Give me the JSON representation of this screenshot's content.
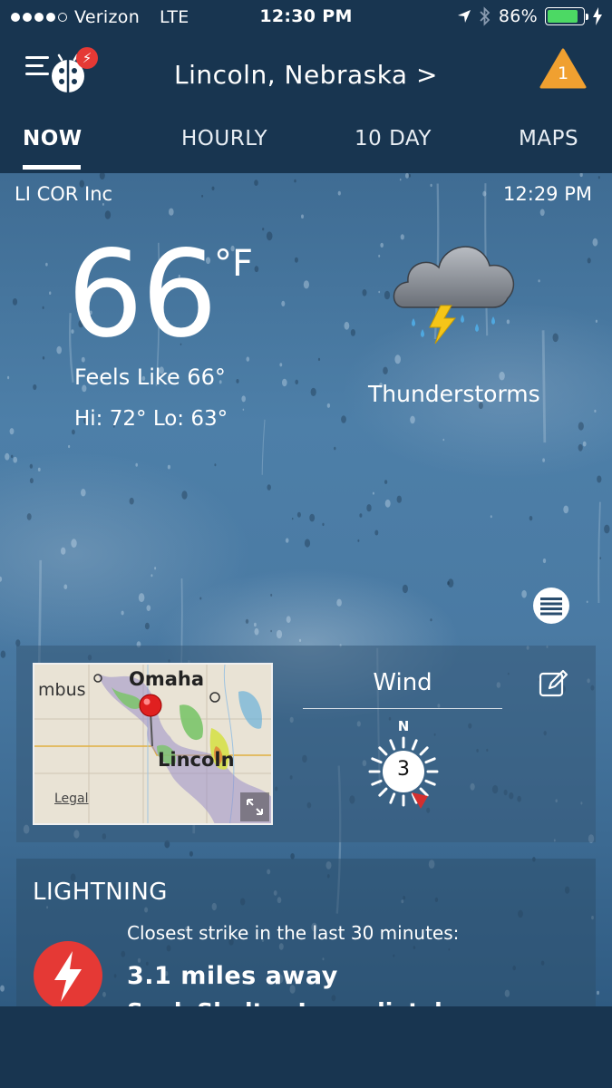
{
  "status_bar": {
    "carrier": "Verizon",
    "network": "LTE",
    "time": "12:30 PM",
    "battery": "86%",
    "battery_level": 0.86
  },
  "header": {
    "logo_badge": "⚡",
    "location": "Lincoln, Nebraska >",
    "alert_count": "1",
    "alert_color": "#f0a030"
  },
  "tabs": [
    {
      "label": "NOW"
    },
    {
      "label": "HOURLY"
    },
    {
      "label": "10 DAY"
    },
    {
      "label": "MAPS"
    }
  ],
  "current": {
    "station": "LI COR Inc",
    "observed_time": "12:29 PM",
    "temperature": "66",
    "unit": "°F",
    "feels_like": "Feels Like 66°",
    "hi_lo": "Hi: 72° Lo: 63°",
    "condition": "Thunderstorms",
    "condition_icon": "thunderstorm-icon"
  },
  "map": {
    "labels": {
      "omaha": "Omaha",
      "mbus": "mbus",
      "lincoln": "Lincoln",
      "legal": "Legal"
    }
  },
  "wind": {
    "title": "Wind",
    "speed": "3",
    "direction_label": "N"
  },
  "lightning": {
    "title": "LIGHTNING",
    "subtitle": "Closest strike in the last 30 minutes:",
    "distance": "3.1 miles away",
    "cut_text": "Seek Shelter Immediately",
    "badge_color": "#e53935"
  }
}
